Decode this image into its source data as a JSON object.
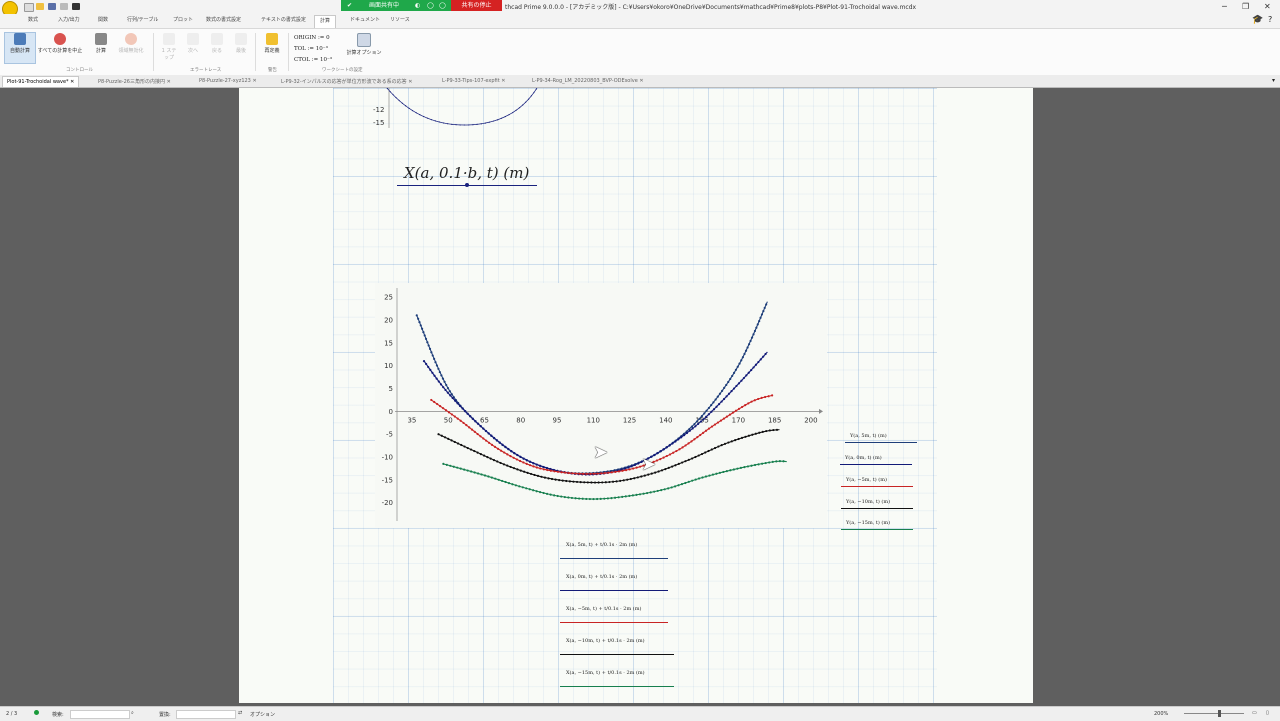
{
  "titlebar": {
    "share_active": "画面共有中",
    "share_stop": "共有の停止",
    "title": "thcad Prime 9.0.0.0 - [アカデミック版] - C:¥Users¥okoro¥OneDrive¥Documents¥mathcad¥Prime8¥plots-P8¥Plot-91-Trochoidal wave.mcdx"
  },
  "ribbon_tabs": [
    "数式",
    "入力/出力",
    "関数",
    "行列/テーブル",
    "プロット",
    "数式の書式設定",
    "テキストの書式設定",
    "計算",
    "ドキュメント",
    "リソース"
  ],
  "active_ribbon_tab": "計算",
  "ribbon": {
    "auto_calc": "自動計算",
    "stop_all": "すべての計算を中止",
    "calculate": "計算",
    "disable": "領域無効化",
    "step1": "1 ステップ",
    "step_in": "次へ",
    "step_out": "戻る",
    "last": "最後",
    "recalc": "再定義",
    "origin": "ORIGIN := 0",
    "tol": "TOL := 10⁻³",
    "ctol": "CTOL := 10⁻³",
    "calc_options": "計算オプション",
    "group_control": "コントロール",
    "group_errortrace": "エラートレース",
    "group_warn": "警告",
    "group_worksheet": "ワークシートの設定"
  },
  "doc_tabs": [
    "Plot-91-Trochoidal wave*",
    "P8-Puzzle-26三角形の内接円",
    "P8-Puzzle-27-xyz123",
    "L-P9-32-インパルスの応答が単位方形波である系の応答",
    "L-P9-33-Tips-107-expfit",
    "L-P9-34-Rog_LM_20220803_BVP-ODEsolve"
  ],
  "worksheet": {
    "top_ticks": [
      "-12",
      "-15"
    ],
    "expression_label": "X(a, 0.1·b, t)  (m)"
  },
  "chart_data": {
    "type": "line",
    "x_ticks": [
      35,
      50,
      65,
      80,
      95,
      110,
      125,
      140,
      155,
      170,
      185,
      200
    ],
    "y_ticks": [
      25,
      20,
      15,
      10,
      5,
      0,
      -5,
      -10,
      -15,
      -20
    ],
    "xlim": [
      28,
      205
    ],
    "ylim": [
      -24,
      27
    ],
    "series": [
      {
        "name": "Y(a, 5m, t)  (m)",
        "color": "#1f3f7a",
        "x": [
          37,
          50,
          65,
          80,
          95,
          110,
          125,
          140,
          155,
          170,
          182
        ],
        "values": [
          21,
          5,
          -4,
          -10,
          -13,
          -13.5,
          -12,
          -8,
          -1,
          10,
          24
        ]
      },
      {
        "name": "Y(a, 0m, t)  (m)",
        "color": "#121a78",
        "x": [
          40,
          50,
          65,
          80,
          95,
          110,
          125,
          140,
          155,
          170,
          182
        ],
        "values": [
          11,
          4,
          -4,
          -10,
          -13,
          -13.8,
          -12.2,
          -8,
          -2,
          6,
          13
        ]
      },
      {
        "name": "Y(a, -5m, t)  (m)",
        "color": "#c82424",
        "x": [
          43,
          55,
          70,
          85,
          100,
          115,
          130,
          145,
          160,
          175,
          184
        ],
        "values": [
          2.5,
          -2,
          -8,
          -12,
          -13.5,
          -13.5,
          -12,
          -8.5,
          -3,
          2,
          3.5
        ]
      },
      {
        "name": "Y(a, -10m, t)  (m)",
        "color": "#111111",
        "x": [
          46,
          60,
          75,
          90,
          105,
          120,
          135,
          150,
          165,
          180,
          187
        ],
        "values": [
          -5,
          -8.5,
          -12,
          -14.5,
          -15.5,
          -15.3,
          -13.5,
          -10.5,
          -7,
          -4.5,
          -4
        ]
      },
      {
        "name": "Y(a, -15m, t)  (m)",
        "color": "#177f4e",
        "x": [
          48,
          65,
          80,
          95,
          110,
          125,
          140,
          155,
          170,
          185,
          190
        ],
        "values": [
          -11.5,
          -14,
          -16.5,
          -18.5,
          -19.2,
          -18.5,
          -17,
          -14.5,
          -12.5,
          -11,
          -11
        ]
      }
    ]
  },
  "legend": [
    "Y(a, 5m, t)  (m)",
    "Y(a, 0m, t)  (m)",
    "Y(a, −5m, t)  (m)",
    "Y(a, −10m, t)  (m)",
    "Y(a, −15m, t)  (m)"
  ],
  "x_axis_labels": [
    "X(a, 5m, t) + t/0.1s · 2m  (m)",
    "X(a, 0m, t) + t/0.1s · 2m  (m)",
    "X(a, −5m, t) + t/0.1s · 2m  (m)",
    "X(a, −10m, t) + t/0.1s · 2m  (m)",
    "X(a, −15m, t) + t/0.1s · 2m  (m)"
  ],
  "status": {
    "page": "2 / 3",
    "search_label": "検索:",
    "replace_label": "置換:",
    "options": "オプション",
    "zoom": "200%"
  }
}
